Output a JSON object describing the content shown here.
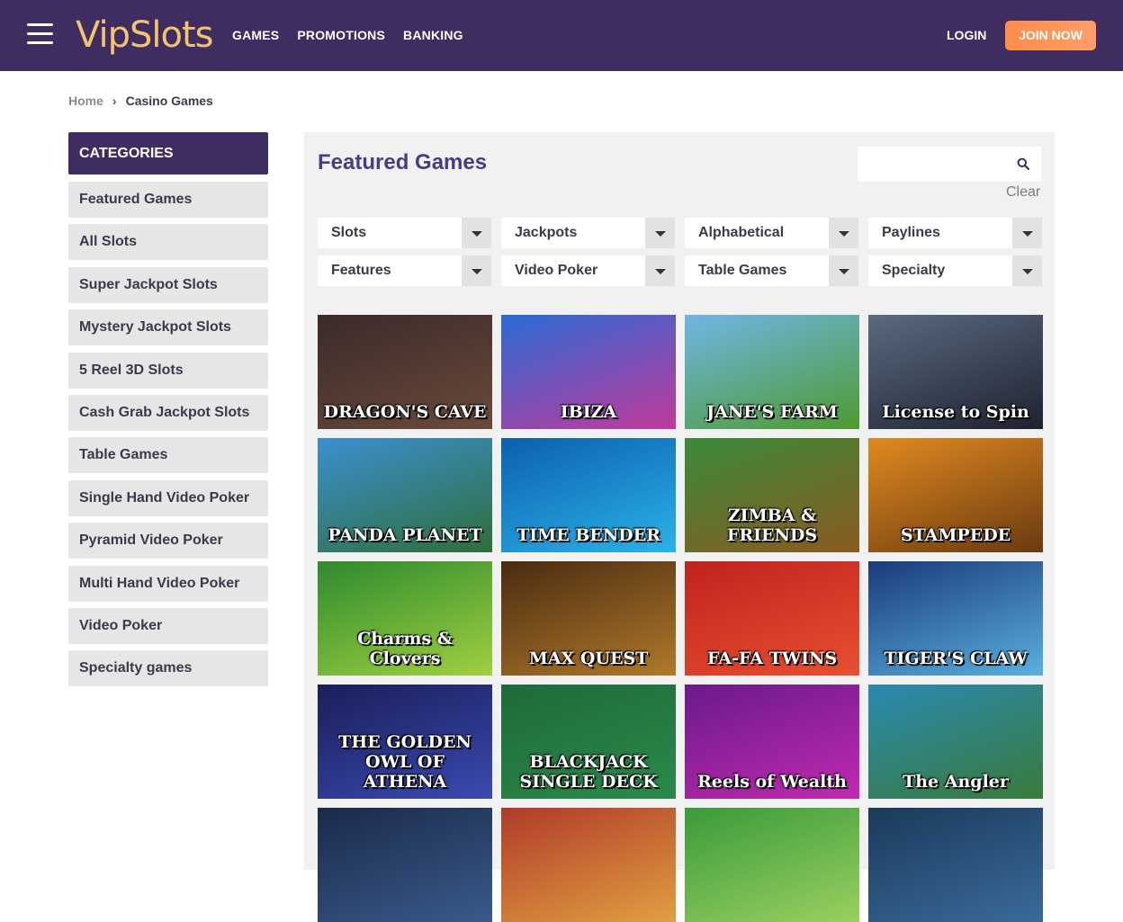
{
  "header": {
    "logo": "VipSlots",
    "nav": [
      "GAMES",
      "PROMOTIONS",
      "BANKING"
    ],
    "login": "LOGIN",
    "join": "JOIN NOW"
  },
  "breadcrumb": {
    "home": "Home",
    "separator": "›",
    "current": "Casino Games"
  },
  "sidebar": {
    "heading": "CATEGORIES",
    "items": [
      "Featured Games",
      "All Slots",
      "Super Jackpot Slots",
      "Mystery Jackpot Slots",
      "5 Reel 3D Slots",
      "Cash Grab Jackpot Slots",
      "Table Games",
      "Single Hand Video Poker",
      "Pyramid Video Poker",
      "Multi Hand Video Poker",
      "Video Poker",
      "Specialty games"
    ]
  },
  "main": {
    "title": "Featured Games",
    "search": {
      "placeholder": "",
      "icon": "search-icon"
    },
    "clear": "Clear",
    "filters": [
      "Slots",
      "Jackpots",
      "Alphabetical",
      "Paylines",
      "Features",
      "Video Poker",
      "Table Games",
      "Specialty"
    ],
    "games": [
      {
        "name": "DRAGON'S CAVE",
        "colors": [
          "#3b2a2a",
          "#6b4a3a"
        ]
      },
      {
        "name": "IBIZA",
        "colors": [
          "#2a6bd6",
          "#c13a9a"
        ]
      },
      {
        "name": "JANE'S FARM",
        "colors": [
          "#6fb6e6",
          "#4e9a2e"
        ]
      },
      {
        "name": "License to Spin",
        "colors": [
          "#5a6a80",
          "#1e2230"
        ]
      },
      {
        "name": "PANDA PLANET",
        "colors": [
          "#3b8fd0",
          "#2f6e3a"
        ]
      },
      {
        "name": "TIME BENDER",
        "colors": [
          "#0c5fb0",
          "#2ab3e8"
        ]
      },
      {
        "name": "ZIMBA & FRIENDS",
        "colors": [
          "#3a8a3a",
          "#8a5a20"
        ]
      },
      {
        "name": "STAMPEDE",
        "colors": [
          "#e08a20",
          "#6a3a10"
        ]
      },
      {
        "name": "Charms & Clovers",
        "colors": [
          "#2e8a2e",
          "#a0d040"
        ]
      },
      {
        "name": "MAX QUEST",
        "colors": [
          "#4a2a10",
          "#b07a2a"
        ]
      },
      {
        "name": "FA-FA TWINS",
        "colors": [
          "#c0221f",
          "#e85030"
        ]
      },
      {
        "name": "TIGER'S CLAW",
        "colors": [
          "#1a3a7a",
          "#5ab0e0"
        ]
      },
      {
        "name": "THE GOLDEN OWL OF ATHENA",
        "colors": [
          "#1a1e5a",
          "#3a4ab0"
        ]
      },
      {
        "name": "BLACKJACK SINGLE DECK",
        "colors": [
          "#1e6a3a",
          "#2a8a4a"
        ]
      },
      {
        "name": "Reels of Wealth",
        "colors": [
          "#6a1a8a",
          "#c02ab0"
        ]
      },
      {
        "name": "The Angler",
        "colors": [
          "#2a8ab0",
          "#3a7a3a"
        ]
      },
      {
        "name": "",
        "colors": [
          "#1a2a4a",
          "#3a5a8a"
        ]
      },
      {
        "name": "",
        "colors": [
          "#b03a2a",
          "#e0a040"
        ]
      },
      {
        "name": "",
        "colors": [
          "#3a9a3a",
          "#9ad060"
        ]
      },
      {
        "name": "",
        "colors": [
          "#1a3a5a",
          "#3a6a9a"
        ]
      }
    ]
  },
  "colors": {
    "header_bg": "#3f2d62",
    "accent": "#4b3a85",
    "join": "#ff8c4a"
  }
}
